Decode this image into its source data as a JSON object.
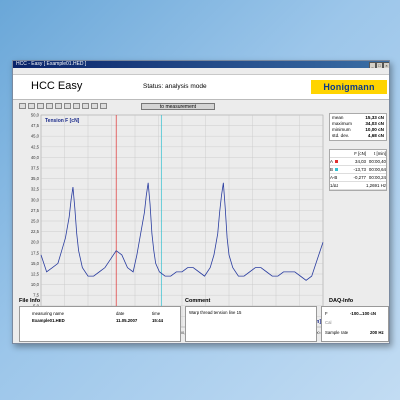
{
  "window": {
    "title": "HCC - Easy [ Example01.HED ]"
  },
  "menu": [
    "File",
    "Output",
    "Settings",
    "Help"
  ],
  "header": {
    "app_title": "HCC Easy",
    "status": "Status:   analysis mode",
    "logo": "Honigmann"
  },
  "toolbar": {
    "to_measurement": "to measurement"
  },
  "colors": {
    "trace": "#2a3da0",
    "marker_red": "#e03030",
    "marker_cyan": "#30c0d0",
    "logo_bg": "#ffd400",
    "logo_text": "#0a3a8a"
  },
  "stats": [
    {
      "label": "mean",
      "value": "15,33 cN"
    },
    {
      "label": "maximum",
      "value": "34,03 cN"
    },
    {
      "label": "minimum",
      "value": "10,00 cN"
    },
    {
      "label": "std. dev.",
      "value": "4,68 cN"
    }
  ],
  "cursor_table": {
    "header": [
      "",
      "F [cN]",
      "t [min]"
    ],
    "rows": [
      [
        "A",
        "34,03",
        "00:00,40"
      ],
      [
        "B",
        "-13,73",
        "00:00,64"
      ],
      [
        "A-B",
        "-0,277",
        "00:00,24"
      ],
      [
        "1/Δt",
        "",
        "1,2691 Hz"
      ]
    ]
  },
  "file_info": {
    "title": "File Info",
    "measuring_name_label": "measuring name",
    "measuring_name": "Example01.HED",
    "date_label": "date",
    "date": "11.05.2007",
    "time_label": "time",
    "time": "15:44"
  },
  "comment": {
    "title": "Comment",
    "text": "Warp thread tension line 15"
  },
  "daq_info": {
    "title": "DAQ-Info",
    "rows": [
      {
        "label": "F",
        "value": "-100...100 cN"
      },
      {
        "label": "Cal",
        "value": ""
      },
      {
        "label": "Sample rate",
        "value": "200 Hz"
      }
    ]
  },
  "chart_data": {
    "type": "line",
    "title": "",
    "ylabel": "Tension F [cN]",
    "xlabel": "t [min]",
    "ylim": [
      0,
      50
    ],
    "xlim": [
      0,
      1.5
    ],
    "yticks": [
      "50,0",
      "47,5",
      "45,0",
      "42,5",
      "40,0",
      "37,5",
      "35,0",
      "32,5",
      "30,0",
      "27,5",
      "25,0",
      "22,5",
      "20,0",
      "17,5",
      "15,0",
      "12,5",
      "10,0",
      "7,5",
      "5,0",
      "2,5",
      "0,0"
    ],
    "xticks": [
      "00:00,00",
      "00:00,13",
      "00:00,25",
      "00:00,38",
      "00:00,50",
      "00:00,63",
      "00:00,75",
      "00:00,88",
      "00:01,00",
      "00:01,13",
      "00:01,25",
      "00:01,38",
      "00:01,50"
    ],
    "grid": true,
    "cursors": [
      {
        "name": "A",
        "x": 0.4,
        "color": "red"
      },
      {
        "name": "B",
        "x": 0.64,
        "color": "cyan"
      }
    ],
    "series": [
      {
        "x": [
          0.0,
          0.03,
          0.06,
          0.09,
          0.11,
          0.13,
          0.15,
          0.16,
          0.17,
          0.18,
          0.19,
          0.2,
          0.22,
          0.25,
          0.28,
          0.31,
          0.34,
          0.37,
          0.4,
          0.43,
          0.46,
          0.49,
          0.51,
          0.53,
          0.55,
          0.56,
          0.57,
          0.58,
          0.59,
          0.6,
          0.61,
          0.63,
          0.66,
          0.69,
          0.72,
          0.75,
          0.78,
          0.81,
          0.84,
          0.87,
          0.9,
          0.92,
          0.94,
          0.95,
          0.96,
          0.97,
          0.98,
          0.99,
          1.0,
          1.02,
          1.05,
          1.08,
          1.11,
          1.14,
          1.17,
          1.2,
          1.23,
          1.26,
          1.29,
          1.32,
          1.35,
          1.38,
          1.41,
          1.44,
          1.47,
          1.5
        ],
        "y": [
          17,
          13,
          14,
          15,
          18,
          21,
          26,
          30,
          33,
          28,
          22,
          18,
          14,
          12,
          12,
          13,
          14,
          16,
          18,
          17,
          14,
          13,
          17,
          22,
          27,
          31,
          34,
          29,
          22,
          18,
          15,
          13,
          12,
          12,
          13,
          13,
          14,
          14,
          13,
          12,
          14,
          17,
          22,
          27,
          31,
          34,
          28,
          21,
          17,
          14,
          12,
          12,
          13,
          14,
          14,
          13,
          12,
          12,
          13,
          13,
          13,
          12,
          11,
          12,
          16,
          20
        ]
      }
    ]
  }
}
